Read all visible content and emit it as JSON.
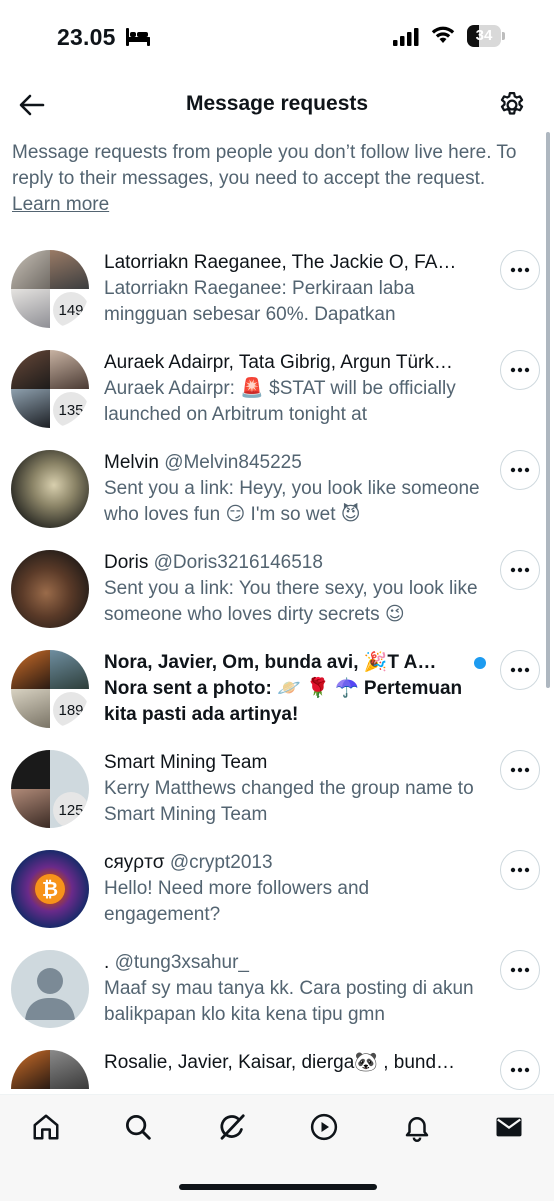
{
  "status_bar": {
    "time": "23.05",
    "battery": "34"
  },
  "header": {
    "title": "Message requests"
  },
  "info": {
    "text": "Message requests from people you don’t follow live here. To reply to their messages, you need to accept the request.",
    "link": "Learn more"
  },
  "requests": [
    {
      "name": "Latorriakn Raeganee, The Jackie O, FA…",
      "handle": "",
      "preview": "Latorriakn Raeganee: Perkiraan laba mingguan sebesar 60%. Dapatkan",
      "badge": "149",
      "unread": false
    },
    {
      "name": "Auraek Adairpr, Tata Gibrig, Argun Türk…",
      "handle": "",
      "preview": "Auraek Adairpr: 🚨 $STAT will be officially launched on Arbitrum tonight at",
      "badge": "135",
      "unread": false
    },
    {
      "name": "Melvin",
      "handle": "@Melvin845225",
      "preview": "Sent you a link: Heyy, you look like someone who loves fun 😏 I'm so wet 😈",
      "badge": "",
      "unread": false
    },
    {
      "name": "Doris",
      "handle": "@Doris3216146518",
      "preview": "Sent you a link: You there sexy, you look like someone who loves dirty secrets 😉",
      "badge": "",
      "unread": false
    },
    {
      "name": "Nora, Javier, Om, bunda avi, 🎉T A…",
      "handle": "",
      "preview": "Nora sent a photo: 🪐 🌹 ☂️ Pertemuan kita pasti ada artinya!",
      "badge": "189",
      "unread": true
    },
    {
      "name": "Smart Mining Team",
      "handle": "",
      "preview": "Kerry Matthews changed the group name to Smart Mining Team",
      "badge": "125",
      "unread": false
    },
    {
      "name": "сяуρтσ",
      "handle": "@crypt2013",
      "preview": "Hello! Need more followers and engagement?",
      "badge": "",
      "unread": false
    },
    {
      "name": ".",
      "handle": "@tung3xsahur_",
      "preview": "Maaf sy mau tanya kk. Cara posting di akun balikpapan klo kita kena tipu  gmn",
      "badge": "",
      "unread": false
    },
    {
      "name": "Rosalie, Javier, Kaisar, dierga🐼 , bund…",
      "handle": "",
      "preview": "",
      "badge": "",
      "unread": false
    }
  ],
  "nav": [
    "home-icon",
    "search-icon",
    "grok-icon",
    "video-icon",
    "notifications-icon",
    "messages-icon"
  ],
  "colors": {
    "accent": "#1d9bf0",
    "secondary_text": "#536471",
    "primary_text": "#0f1419"
  }
}
